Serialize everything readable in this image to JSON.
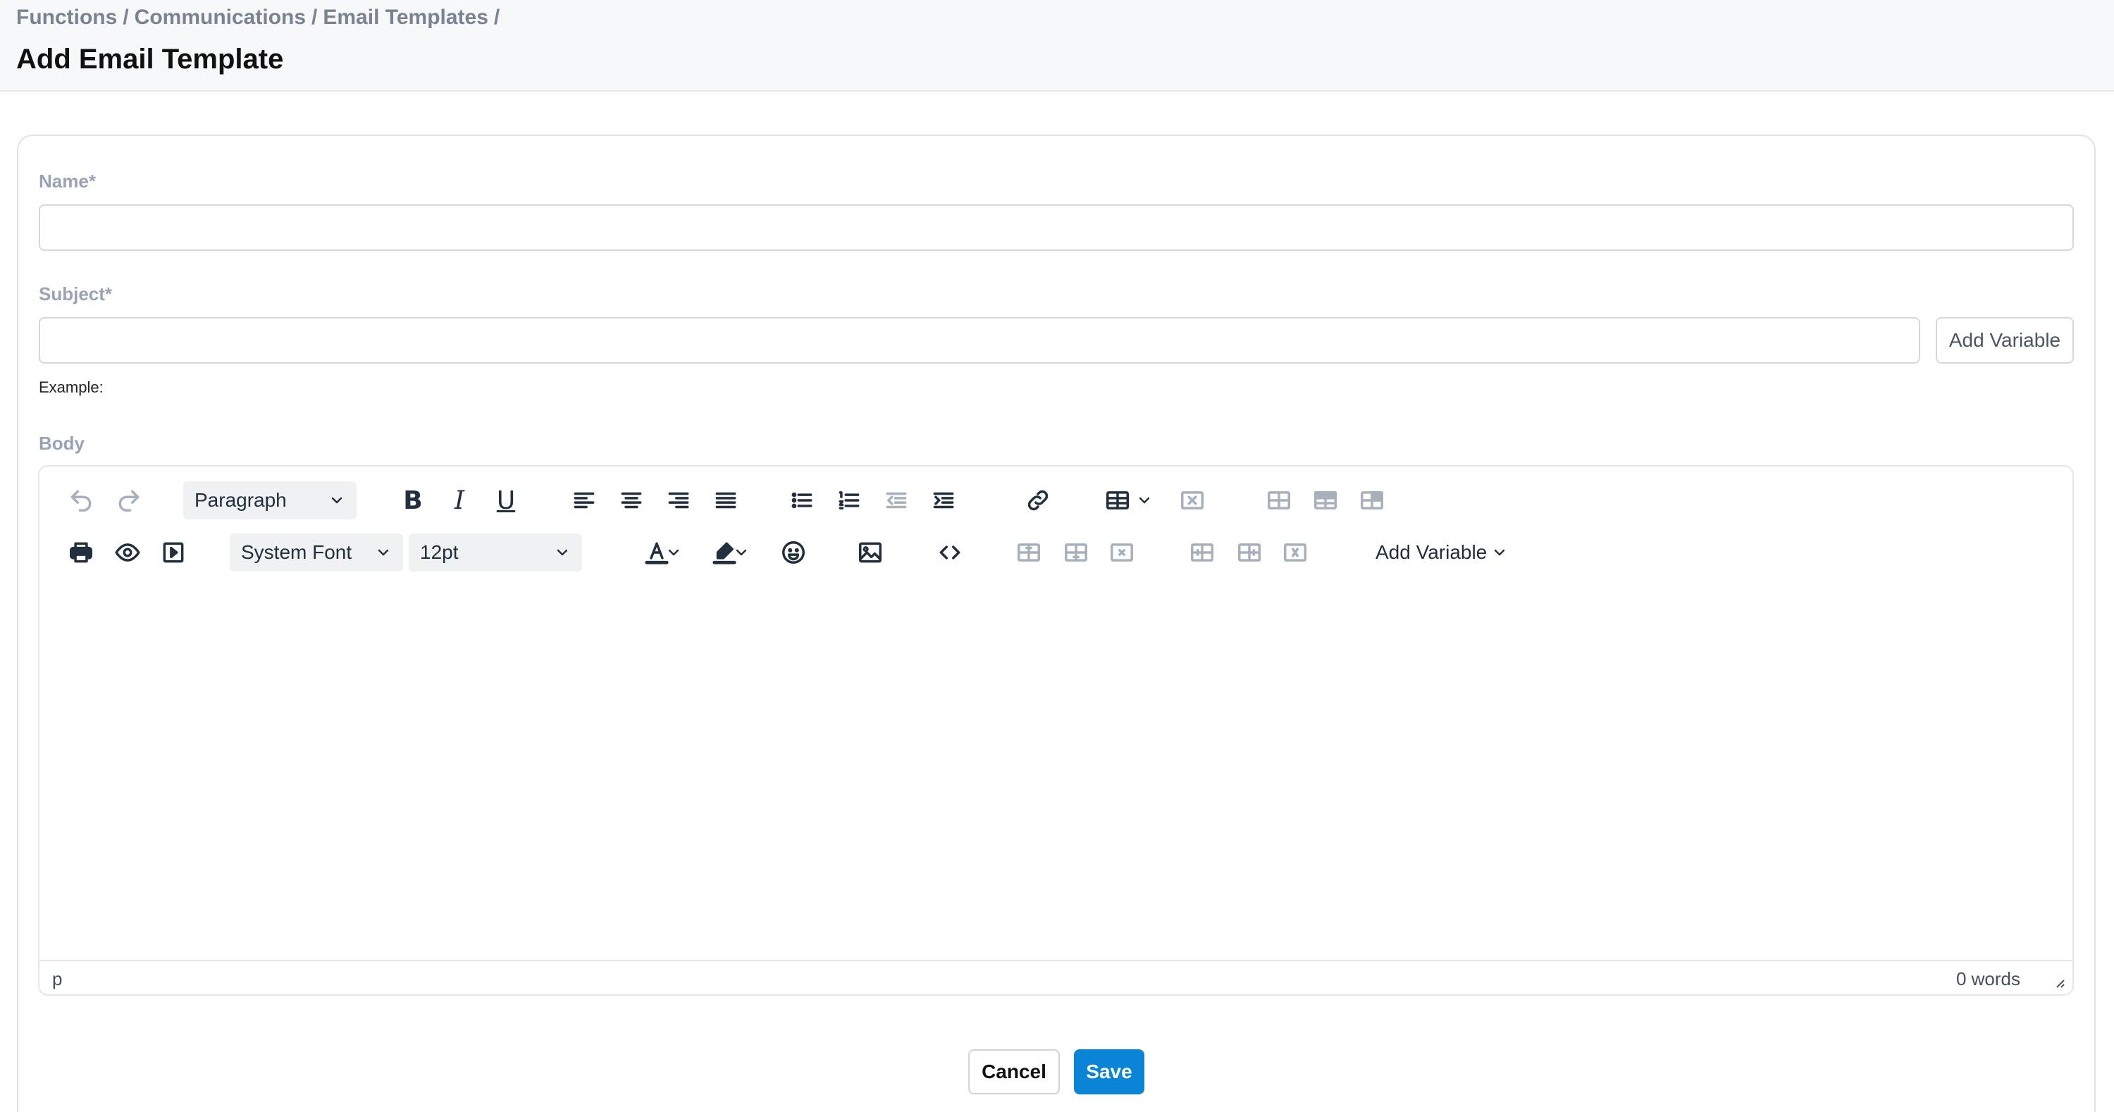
{
  "breadcrumb": [
    "Functions",
    "Communications",
    "Email Templates"
  ],
  "breadcrumb_separator": "/",
  "page_title": "Add Email Template",
  "form": {
    "name_label": "Name*",
    "name_value": "",
    "subject_label": "Subject*",
    "subject_value": "",
    "add_variable_label": "Add Variable",
    "example_label": "Example:",
    "body_label": "Body"
  },
  "editor": {
    "block_format": "Paragraph",
    "font_family": "System Font",
    "font_size": "12pt",
    "add_variable_menu": "Add Variable",
    "status_path": "p",
    "word_count": "0 words",
    "icons_row1": [
      "undo-icon",
      "redo-icon",
      "bold-icon",
      "italic-icon",
      "underline-icon",
      "align-left-icon",
      "align-center-icon",
      "align-right-icon",
      "justify-icon",
      "bullet-list-icon",
      "numbered-list-icon",
      "outdent-icon",
      "indent-icon",
      "link-icon",
      "table-icon",
      "delete-table-icon",
      "table-row-icon",
      "table-header-icon",
      "table-cell-icon"
    ],
    "icons_row2": [
      "print-icon",
      "preview-icon",
      "media-icon",
      "text-color-icon",
      "highlight-color-icon",
      "emoji-icon",
      "image-icon",
      "source-code-icon",
      "insert-row-before-icon",
      "insert-row-after-icon",
      "delete-row-icon",
      "insert-column-before-icon",
      "insert-column-after-icon",
      "delete-column-icon"
    ]
  },
  "actions": {
    "cancel_label": "Cancel",
    "save_label": "Save"
  },
  "colors": {
    "primary": "#0a84d6",
    "label": "#9aa3b5",
    "breadcrumb": "#7a8391"
  }
}
